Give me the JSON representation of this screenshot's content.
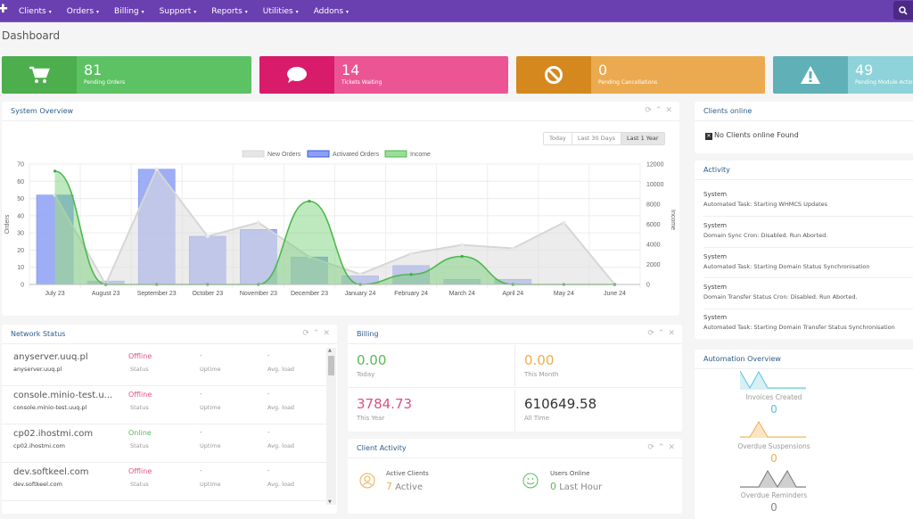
{
  "nav": {
    "items": [
      "Clients",
      "Orders",
      "Billing",
      "Support",
      "Reports",
      "Utilities",
      "Addons"
    ],
    "search_icon": "search-icon"
  },
  "page_title": "Dashboard",
  "stats": [
    {
      "value": "81",
      "label": "Pending Orders",
      "icon": "cart-icon",
      "color_dark": "#4cae4c",
      "color_light": "#5cc264"
    },
    {
      "value": "14",
      "label": "Tickets Waiting",
      "icon": "comment-icon",
      "color_dark": "#d81b6a",
      "color_light": "#ec5594"
    },
    {
      "value": "0",
      "label": "Pending Cancellations",
      "icon": "ban-icon",
      "color_dark": "#d4881d",
      "color_light": "#ebaa4f"
    },
    {
      "value": "49",
      "label": "Pending Module Actions",
      "icon": "warning-icon",
      "color_dark": "#5fb0b7",
      "color_light": "#8dd3d9"
    }
  ],
  "system_overview": {
    "title": "System Overview",
    "ranges": [
      "Today",
      "Last 30 Days",
      "Last 1 Year"
    ],
    "active_range": "Last 1 Year"
  },
  "chart_data": {
    "type": "bar",
    "title": "",
    "categories": [
      "July 23",
      "August 23",
      "September 23",
      "October 23",
      "November 23",
      "December 23",
      "January 24",
      "February 24",
      "March 24",
      "April 24",
      "May 24",
      "June 24"
    ],
    "series": [
      {
        "name": "New Orders",
        "type": "line",
        "axis": "left",
        "color": "#d8d8d8",
        "values": [
          52,
          0,
          67,
          28,
          36,
          16,
          6,
          18,
          23,
          21,
          36,
          0
        ]
      },
      {
        "name": "Activated Orders",
        "type": "bar",
        "axis": "left",
        "color": "#7b93f2",
        "values": [
          52,
          2,
          67,
          28,
          32,
          16,
          5,
          11,
          3,
          3,
          0,
          0
        ]
      },
      {
        "name": "Income",
        "type": "area",
        "axis": "right",
        "color": "#5cc264",
        "values": [
          11300,
          0,
          0,
          0,
          0,
          8300,
          0,
          1000,
          2800,
          0,
          0,
          0
        ]
      }
    ],
    "ylabel": "Orders",
    "y2label": "Income",
    "ylim": [
      0,
      70
    ],
    "y2lim": [
      0,
      12000
    ],
    "yticks": [
      0,
      10,
      20,
      30,
      40,
      50,
      60,
      70
    ],
    "y2ticks": [
      0,
      2000,
      4000,
      6000,
      8000,
      10000,
      12000
    ],
    "legend": "top",
    "grid": true
  },
  "clients_online": {
    "title": "Clients online",
    "message": "No Clients online Found"
  },
  "activity": {
    "title": "Activity",
    "items": [
      {
        "who": "System",
        "what": "Automated Task: Starting WHMCS Updates"
      },
      {
        "who": "System",
        "what": "Domain Sync Cron: Disabled. Run Aborted."
      },
      {
        "who": "System",
        "what": "Automated Task: Starting Domain Status Synchronisation"
      },
      {
        "who": "System",
        "what": "Domain Transfer Status Cron: Disabled. Run Aborted."
      },
      {
        "who": "System",
        "what": "Automated Task: Starting Domain Transfer Status Synchronisation"
      }
    ]
  },
  "network_status": {
    "title": "Network Status",
    "rows": [
      {
        "name": "anyserver.uuq.pl",
        "host": "anyserver.uuq.pl",
        "status": "Offline",
        "status_label": "Status",
        "uptime": "-",
        "uptime_label": "Uptime",
        "load": "-",
        "load_label": "Avg. load"
      },
      {
        "name": "console.minio-test.u...",
        "host": "console.minio-test.uuq.pl",
        "status": "Offline",
        "status_label": "Status",
        "uptime": "-",
        "uptime_label": "Uptime",
        "load": "-",
        "load_label": "Avg. load"
      },
      {
        "name": "cp02.ihostmi.com",
        "host": "cp02.ihostmi.com",
        "status": "Online",
        "status_label": "Status",
        "uptime": "-",
        "uptime_label": "Uptime",
        "load": "-",
        "load_label": "Avg. load"
      },
      {
        "name": "dev.softkeel.com",
        "host": "dev.softkeel.com",
        "status": "Offline",
        "status_label": "Status",
        "uptime": "-",
        "uptime_label": "Uptime",
        "load": "-",
        "load_label": "Avg. load"
      }
    ]
  },
  "billing": {
    "title": "Billing",
    "today": {
      "value": "0.00",
      "label": "Today",
      "color": "#5cb85c"
    },
    "month": {
      "value": "0.00",
      "label": "This Month",
      "color": "#f0ad4e"
    },
    "year": {
      "value": "3784.73",
      "label": "This Year",
      "color": "#d9537f"
    },
    "all": {
      "value": "610649.58",
      "label": "All Time",
      "color": "#333333"
    }
  },
  "client_activity": {
    "title": "Client Activity",
    "active_label": "Active Clients",
    "active_count": "7",
    "active_suffix": "Active",
    "online_label": "Users Online",
    "online_count": "0",
    "online_suffix": "Last Hour"
  },
  "automation": {
    "title": "Automation Overview",
    "items": [
      {
        "label": "Invoices Created",
        "value": "0",
        "color": "#5bc0de"
      },
      {
        "label": "Overdue Suspensions",
        "value": "0",
        "color": "#f0ad4e"
      },
      {
        "label": "Overdue Reminders",
        "value": "0",
        "color": "#888888"
      }
    ]
  }
}
